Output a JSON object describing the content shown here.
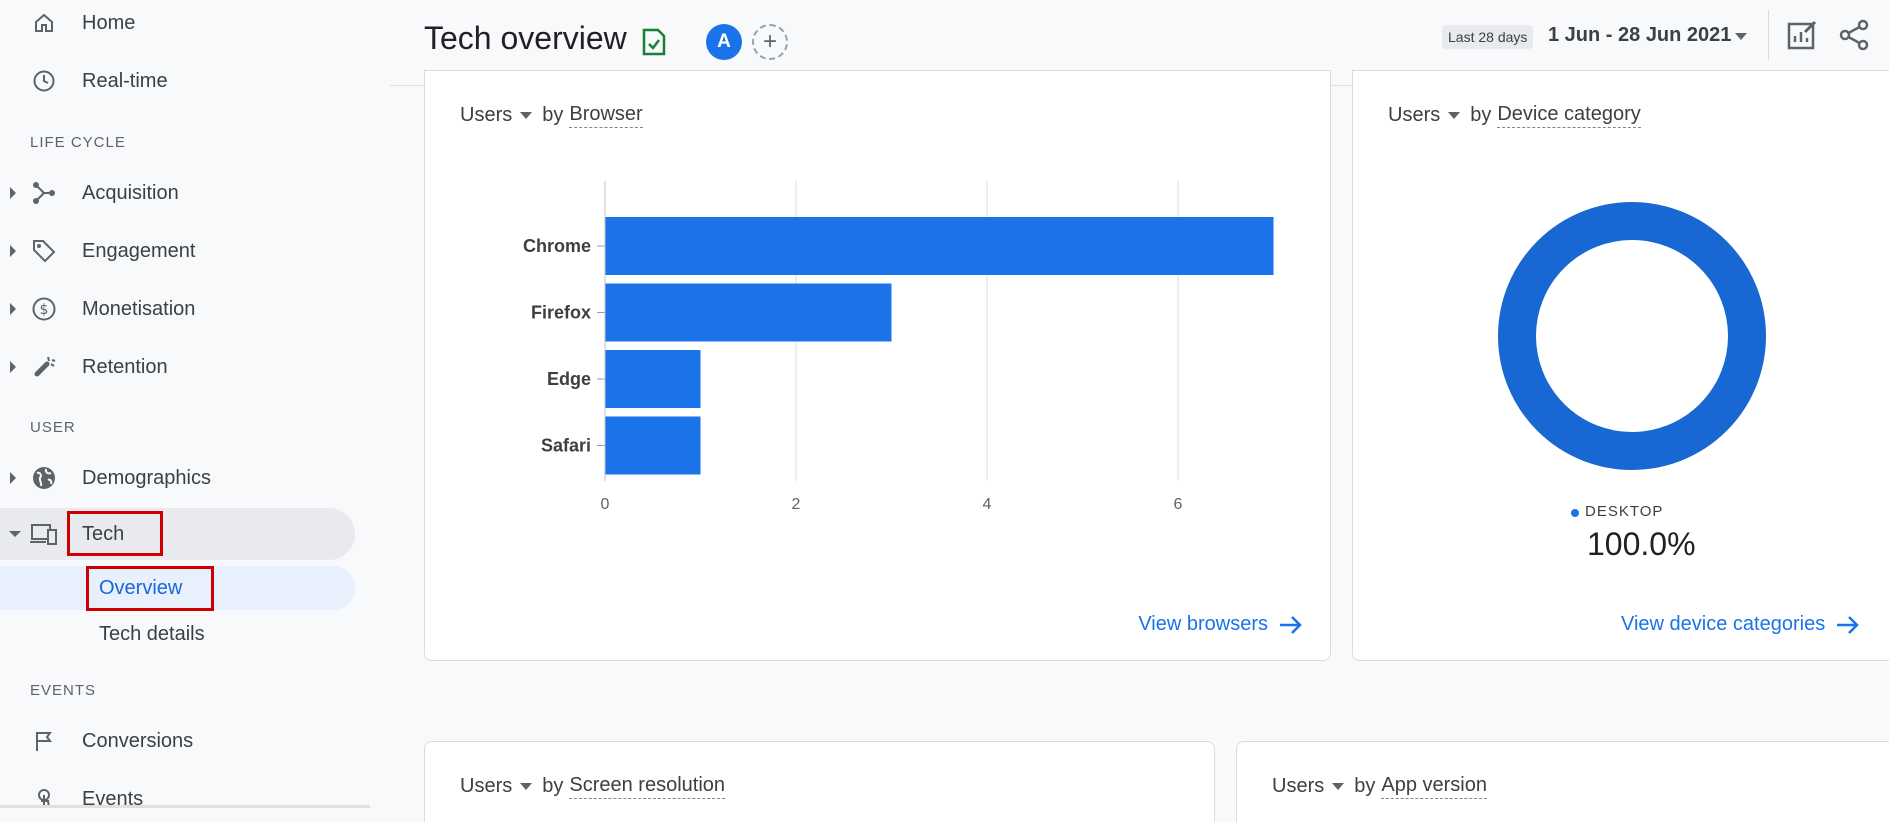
{
  "sidebar": {
    "home": "Home",
    "realtime": "Real-time",
    "lifecycle_title": "LIFE CYCLE",
    "acquisition": "Acquisition",
    "engagement": "Engagement",
    "monetisation": "Monetisation",
    "retention": "Retention",
    "user_title": "USER",
    "demographics": "Demographics",
    "tech": "Tech",
    "overview": "Overview",
    "tech_details": "Tech details",
    "events_title": "EVENTS",
    "conversions": "Conversions",
    "events": "Events"
  },
  "header": {
    "title": "Tech overview",
    "avatar_letter": "A",
    "add_symbol": "+",
    "date_chip": "Last 28 days",
    "date_range": "1 Jun - 28 Jun 2021"
  },
  "cards": {
    "browser": {
      "metric": "Users",
      "by": "by",
      "dimension": "Browser",
      "link": "View browsers"
    },
    "device": {
      "metric": "Users",
      "by": "by",
      "dimension": "Device category",
      "legend_label": "DESKTOP",
      "legend_value": "100.0%",
      "link": "View device categories"
    },
    "screen": {
      "metric": "Users",
      "by": "by",
      "dimension": "Screen resolution"
    },
    "app": {
      "metric": "Users",
      "by": "by",
      "dimension": "App version"
    }
  },
  "chart_data": [
    {
      "type": "bar",
      "orientation": "horizontal",
      "categories": [
        "Chrome",
        "Firefox",
        "Edge",
        "Safari"
      ],
      "values": [
        7,
        3,
        1,
        1
      ],
      "xticks": [
        "0",
        "2",
        "4",
        "6"
      ],
      "xlim": [
        0,
        7
      ],
      "grid": true,
      "color": "#1a73e8"
    },
    {
      "type": "pie",
      "donut": true,
      "labels": [
        "DESKTOP"
      ],
      "values": [
        100.0
      ],
      "color": "#1967d2"
    }
  ],
  "colors": {
    "accent": "#1a73e8",
    "highlight_box": "#cc0000"
  }
}
